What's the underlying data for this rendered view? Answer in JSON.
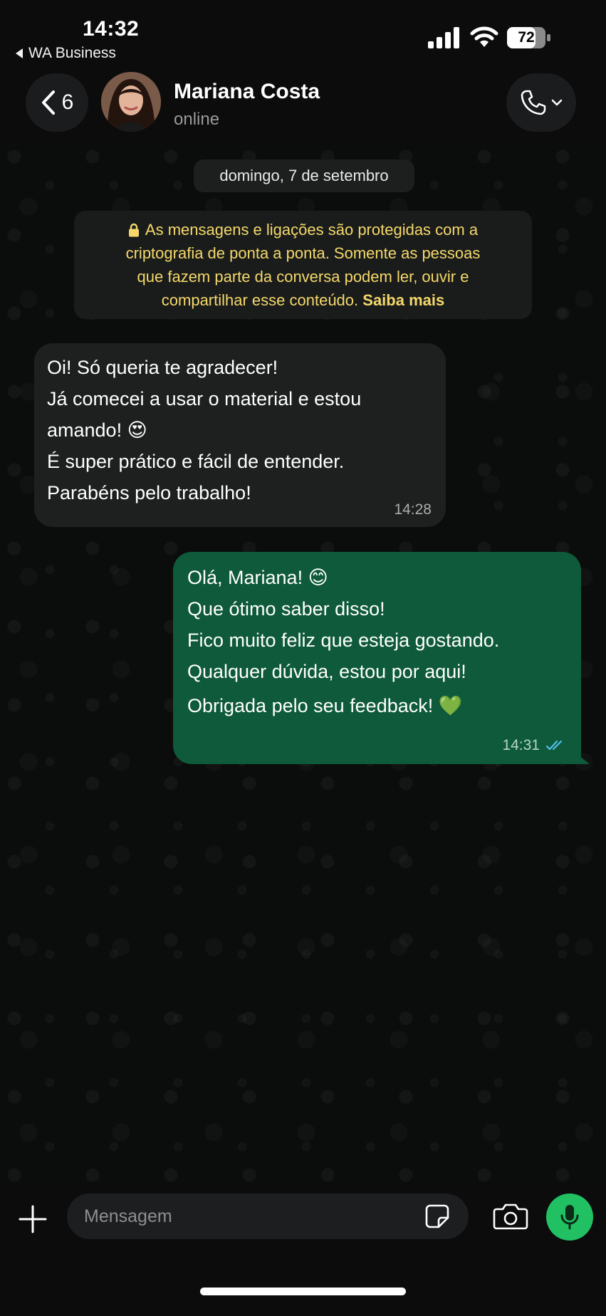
{
  "status_bar": {
    "time": "14:32",
    "back_app": "WA Business",
    "battery": "72"
  },
  "header": {
    "unread_count": "6",
    "contact_name": "Mariana Costa",
    "contact_status": "online"
  },
  "chat": {
    "date": "domingo, 7 de setembro",
    "encryption_notice": {
      "text": "As mensagens e ligações são protegidas com a criptografia de ponta a ponta. Somente as pessoas que fazem parte da conversa podem ler, ouvir e compartilhar esse conteúdo.",
      "line1": "As mensagens e ligações são protegidas com a",
      "line2": "criptografia de ponta a ponta. Somente as pessoas",
      "line3": "que fazem parte da conversa podem ler, ouvir e",
      "line4": "compartilhar esse conteúdo.",
      "learn_more": "Saiba mais"
    },
    "messages": [
      {
        "direction": "incoming",
        "lines": [
          "Oi! Só queria te agradecer!",
          "Já comecei a usar o material e estou",
          "amando! 😍",
          "É super prático e fácil de entender.",
          "Parabéns pelo trabalho!"
        ],
        "time": "14:28"
      },
      {
        "direction": "outgoing",
        "lines": [
          "Olá, Mariana! 😊",
          "Que ótimo saber disso!",
          "Fico muito feliz que esteja gostando.",
          "Qualquer dúvida, estou por aqui!",
          "Obrigada pelo seu feedback! 💚"
        ],
        "time": "14:31",
        "status": "read"
      }
    ]
  },
  "composer": {
    "placeholder": "Mensagem"
  },
  "colors": {
    "outgoing_bubble": "#0e5a3a",
    "incoming_bubble": "#1e2020",
    "notice_text": "#f4d86b",
    "mic_button": "#21c063",
    "read_ticks": "#53bdeb"
  }
}
